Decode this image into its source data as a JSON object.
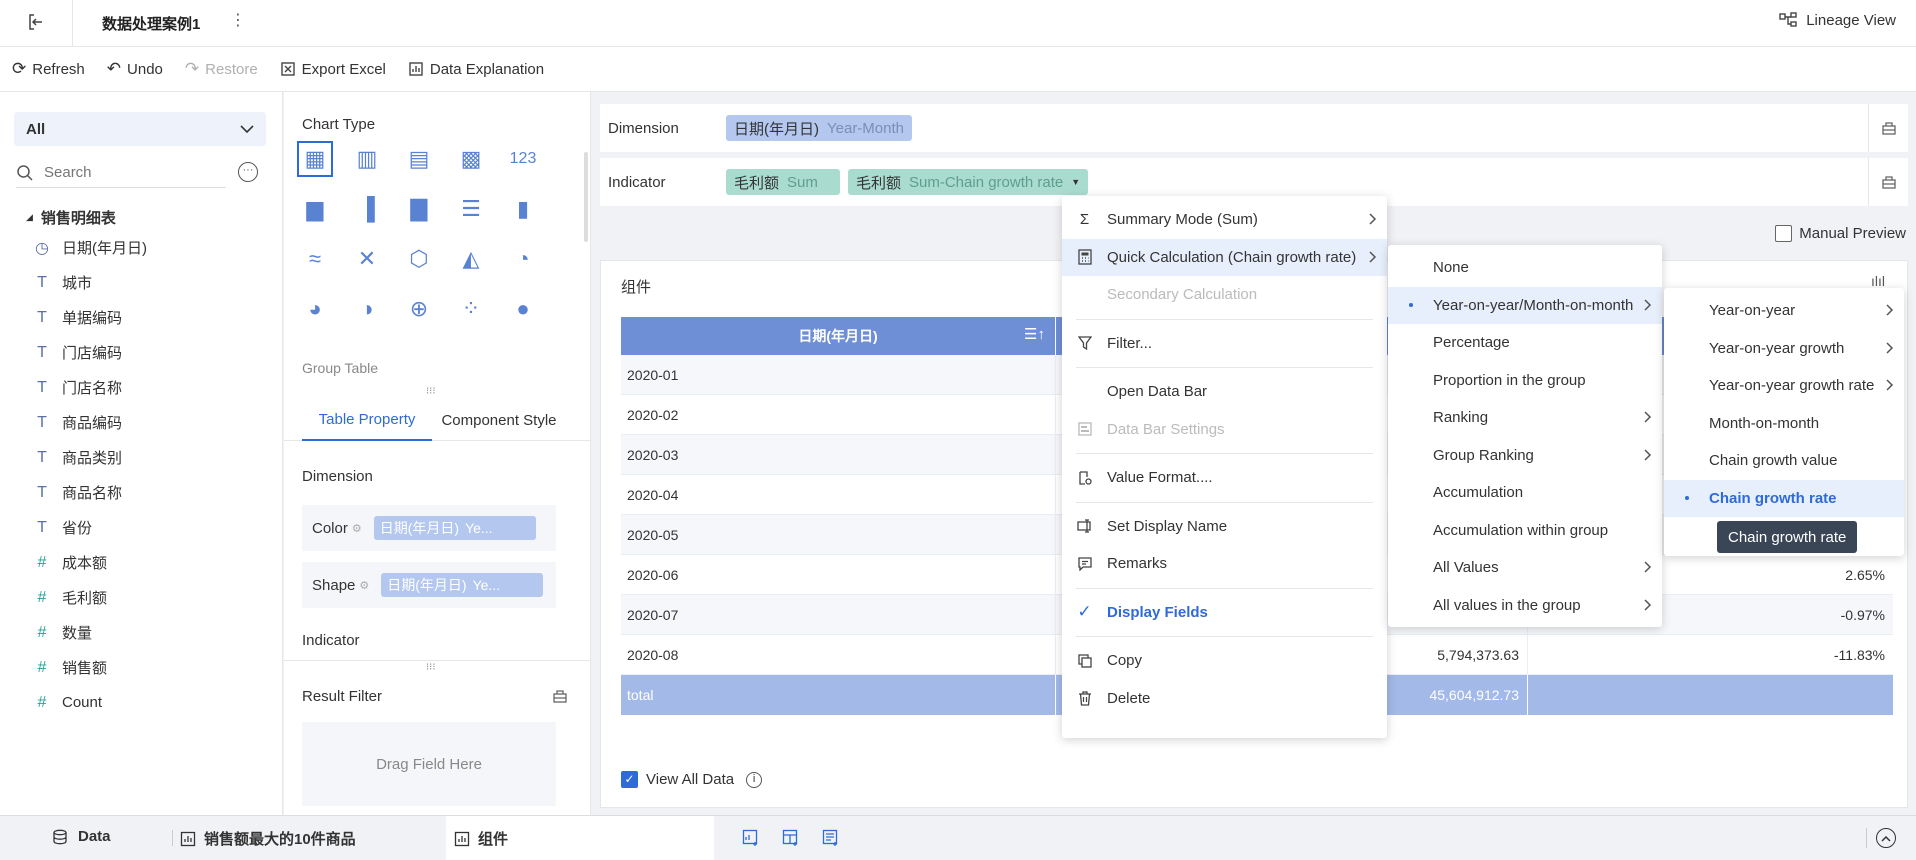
{
  "header": {
    "title": "数据处理案例1",
    "lineage_label": "Lineage View"
  },
  "toolbar": {
    "refresh": "Refresh",
    "undo": "Undo",
    "restore": "Restore",
    "export": "Export Excel",
    "explain": "Data Explanation"
  },
  "left": {
    "selector": "All",
    "search_placeholder": "Search",
    "table_name": "销售明细表",
    "fields": [
      {
        "icon": "clock-icon",
        "glyph": "◷",
        "label": "日期(年月日)",
        "color": "#4a7bd0"
      },
      {
        "icon": "text-icon",
        "glyph": "T",
        "label": "城市",
        "color": "#4a7bd0"
      },
      {
        "icon": "text-icon",
        "glyph": "T",
        "label": "单据编码",
        "color": "#4a7bd0"
      },
      {
        "icon": "text-icon",
        "glyph": "T",
        "label": "门店编码",
        "color": "#4a7bd0"
      },
      {
        "icon": "text-icon",
        "glyph": "T",
        "label": "门店名称",
        "color": "#4a7bd0"
      },
      {
        "icon": "text-icon",
        "glyph": "T",
        "label": "商品编码",
        "color": "#4a7bd0"
      },
      {
        "icon": "text-icon",
        "glyph": "T",
        "label": "商品类别",
        "color": "#4a7bd0"
      },
      {
        "icon": "text-icon",
        "glyph": "T",
        "label": "商品名称",
        "color": "#4a7bd0"
      },
      {
        "icon": "text-icon",
        "glyph": "T",
        "label": "省份",
        "color": "#4a7bd0"
      },
      {
        "icon": "number-icon",
        "glyph": "#",
        "label": "成本额",
        "color": "#2aa198"
      },
      {
        "icon": "number-icon",
        "glyph": "#",
        "label": "毛利额",
        "color": "#2aa198"
      },
      {
        "icon": "number-icon",
        "glyph": "#",
        "label": "数量",
        "color": "#2aa198"
      },
      {
        "icon": "number-icon",
        "glyph": "#",
        "label": "销售额",
        "color": "#2aa198"
      },
      {
        "icon": "number-icon",
        "glyph": "#",
        "label": "Count",
        "color": "#2aa198"
      }
    ]
  },
  "mid": {
    "chart_type_label": "Chart Type",
    "group_table_label": "Group Table",
    "tabs": [
      "Table Property",
      "Component Style"
    ],
    "dimension_label": "Dimension",
    "color_label": "Color",
    "shape_label": "Shape",
    "dim_pill": "日期(年月日)",
    "dim_pill_sub": "Ye...",
    "indicator_label": "Indicator",
    "result_filter_label": "Result Filter",
    "drag_hint": "Drag Field Here"
  },
  "shelves": {
    "dimension_label": "Dimension",
    "dimension_pill": {
      "name": "日期(年月日)",
      "sub": "Year-Month"
    },
    "indicator_label": "Indicator",
    "indicator_pills": [
      {
        "name": "毛利额",
        "sub": "Sum"
      },
      {
        "name": "毛利额",
        "sub": "Sum-Chain growth rate"
      }
    ],
    "manual_preview": "Manual Preview"
  },
  "component": {
    "title": "组件",
    "col_header": "日期(年月日)",
    "rows": [
      {
        "date": "2020-01",
        "v1": "",
        "v2": ""
      },
      {
        "date": "2020-02",
        "v1": "",
        "v2": ""
      },
      {
        "date": "2020-03",
        "v1": "",
        "v2": ""
      },
      {
        "date": "2020-04",
        "v1": "",
        "v2": ""
      },
      {
        "date": "2020-05",
        "v1": "",
        "v2": ""
      },
      {
        "date": "2020-06",
        "v1": "",
        "v2": "2.65%"
      },
      {
        "date": "2020-07",
        "v1": "",
        "v2": "-0.97%"
      },
      {
        "date": "2020-08",
        "v1": "5,794,373.63",
        "v2": "-11.83%"
      }
    ],
    "total_label": "total",
    "total_value": "45,604,912.73",
    "view_all": "View All Data"
  },
  "menu1": {
    "summary": "Summary Mode (Sum)",
    "quick_calc": "Quick Calculation (Chain growth rate)",
    "secondary": "Secondary Calculation",
    "filter": "Filter...",
    "open_bar": "Open Data Bar",
    "bar_settings": "Data Bar Settings",
    "value_format": "Value Format....",
    "set_name": "Set Display Name",
    "remarks": "Remarks",
    "display_fields": "Display Fields",
    "copy": "Copy",
    "delete": "Delete"
  },
  "menu2": {
    "items": [
      "None",
      "Year-on-year/Month-on-month",
      "Percentage",
      "Proportion in the group",
      "Ranking",
      "Group Ranking",
      "Accumulation",
      "Accumulation within group",
      "All Values",
      "All values in the group"
    ]
  },
  "menu3": {
    "items": [
      "Year-on-year",
      "Year-on-year growth",
      "Year-on-year growth rate",
      "Month-on-month",
      "Chain growth value",
      "Chain growth rate"
    ],
    "tooltip": "Chain growth rate"
  },
  "bottom": {
    "data_tab": "Data",
    "tab1": "销售额最大的10件商品",
    "tab2": "组件"
  },
  "colors": {
    "accent": "#2f6bd8",
    "header_blue": "#6e8fd6",
    "total_blue": "#a3b9e8",
    "pill_blue": "#b3c7ef",
    "pill_green": "#a9dccf",
    "highlight": "#e8effc"
  }
}
